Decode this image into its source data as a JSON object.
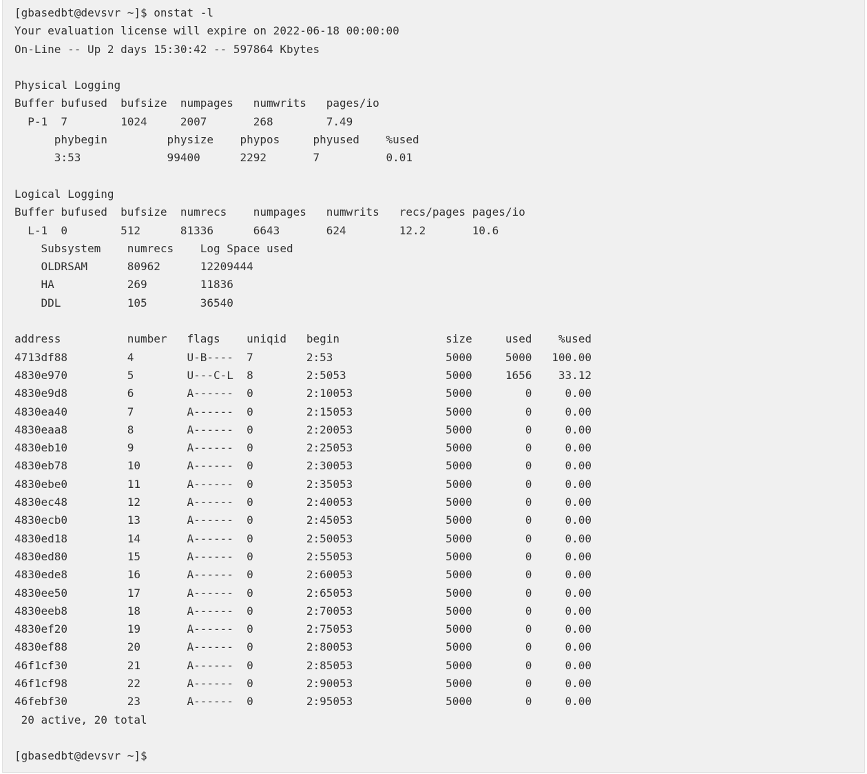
{
  "prompt_command": "[gbasedbt@devsvr ~]$ onstat -l",
  "license_notice": "Your evaluation license will expire on 2022-06-18 00:00:00",
  "status_line": "On-Line -- Up 2 days 15:30:42 -- 597864 Kbytes",
  "physical_logging": {
    "heading": "Physical Logging",
    "buffer_header": "Buffer bufused  bufsize  numpages   numwrits   pages/io",
    "buffer_row": "  P-1  7        1024     2007       268        7.49",
    "phys_header": "      phybegin         physize    phypos     phyused    %used",
    "phys_row": "      3:53             99400      2292       7          0.01"
  },
  "logical_logging": {
    "heading": "Logical Logging",
    "buffer_header": "Buffer bufused  bufsize  numrecs    numpages   numwrits   recs/pages pages/io",
    "buffer_row": "  L-1  0        512      81336      6643       624        12.2       10.6",
    "subsystem_header": "    Subsystem    numrecs    Log Space used",
    "subsystems": [
      "    OLDRSAM      80962      12209444",
      "    HA           269        11836",
      "    DDL          105        36540"
    ]
  },
  "log_table": {
    "header": "address          number   flags    uniqid   begin                size     used    %used",
    "rows": [
      "4713df88         4        U-B----  7        2:53                 5000     5000   100.00",
      "4830e970         5        U---C-L  8        2:5053               5000     1656    33.12",
      "4830e9d8         6        A------  0        2:10053              5000        0     0.00",
      "4830ea40         7        A------  0        2:15053              5000        0     0.00",
      "4830eaa8         8        A------  0        2:20053              5000        0     0.00",
      "4830eb10         9        A------  0        2:25053              5000        0     0.00",
      "4830eb78         10       A------  0        2:30053              5000        0     0.00",
      "4830ebe0         11       A------  0        2:35053              5000        0     0.00",
      "4830ec48         12       A------  0        2:40053              5000        0     0.00",
      "4830ecb0         13       A------  0        2:45053              5000        0     0.00",
      "4830ed18         14       A------  0        2:50053              5000        0     0.00",
      "4830ed80         15       A------  0        2:55053              5000        0     0.00",
      "4830ede8         16       A------  0        2:60053              5000        0     0.00",
      "4830ee50         17       A------  0        2:65053              5000        0     0.00",
      "4830eeb8         18       A------  0        2:70053              5000        0     0.00",
      "4830ef20         19       A------  0        2:75053              5000        0     0.00",
      "4830ef88         20       A------  0        2:80053              5000        0     0.00",
      "46f1cf30         21       A------  0        2:85053              5000        0     0.00",
      "46f1cf98         22       A------  0        2:90053              5000        0     0.00",
      "46febf30         23       A------  0        2:95053              5000        0     0.00"
    ],
    "summary": " 20 active, 20 total"
  },
  "final_prompt": "[gbasedbt@devsvr ~]$"
}
